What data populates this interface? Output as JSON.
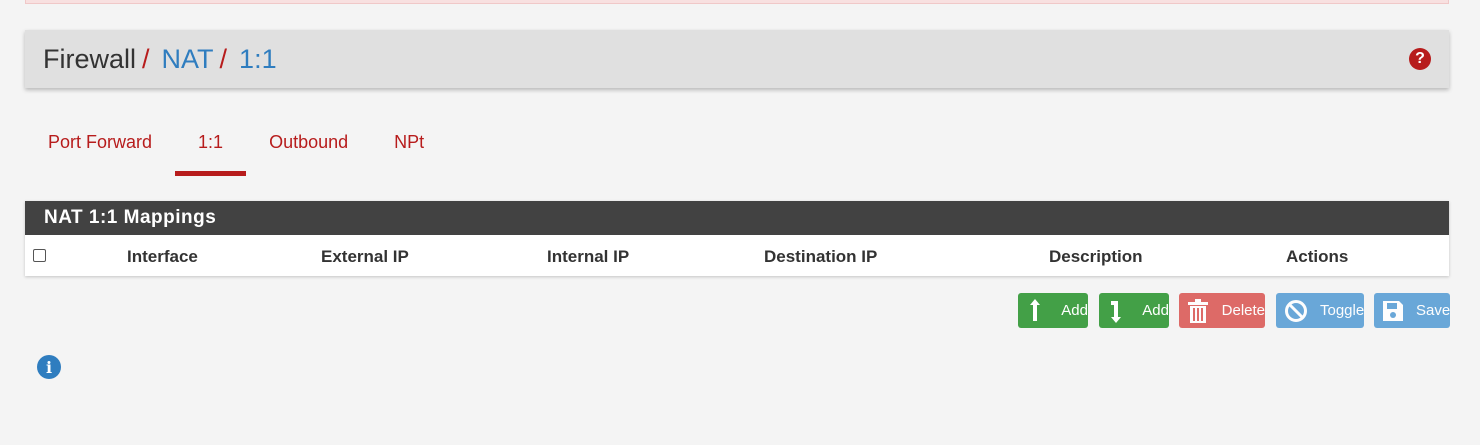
{
  "breadcrumb": {
    "items": [
      "Firewall",
      "NAT",
      "1:1"
    ],
    "separator": "/"
  },
  "help": {
    "icon": "question-circle-icon",
    "glyph": "?"
  },
  "tabs": [
    {
      "label": "Port Forward",
      "active": false
    },
    {
      "label": "1:1",
      "active": true
    },
    {
      "label": "Outbound",
      "active": false
    },
    {
      "label": "NPt",
      "active": false
    }
  ],
  "panel": {
    "title": "NAT 1:1 Mappings",
    "columns": [
      "Interface",
      "External IP",
      "Internal IP",
      "Destination IP",
      "Description",
      "Actions"
    ],
    "rows": []
  },
  "actions": {
    "add_top": "Add",
    "add_bottom": "Add",
    "delete": "Delete",
    "toggle": "Toggle",
    "save": "Save"
  },
  "info": {
    "icon": "info-circle-icon",
    "glyph": "i"
  },
  "colors": {
    "accent": "#b71c1c",
    "link": "#2f7dbf",
    "green": "#43a047",
    "red": "#d9534f",
    "blue": "#5b9fd6",
    "panel_header": "#424242"
  }
}
